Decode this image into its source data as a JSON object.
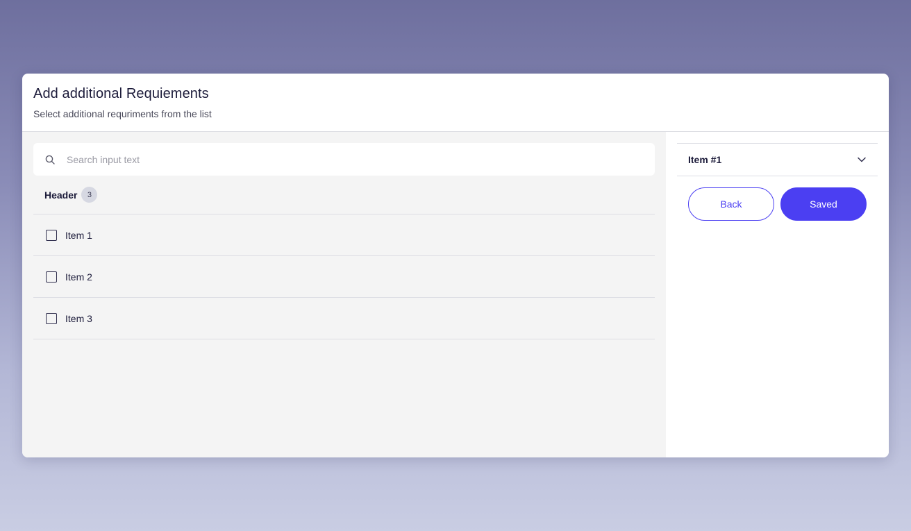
{
  "modal": {
    "title": "Add additional Requiements",
    "subtitle": "Select additional requriments from the list"
  },
  "search": {
    "placeholder": "Search input text",
    "icon": "search-icon"
  },
  "list": {
    "header_label": "Header",
    "count": "3",
    "items": [
      {
        "label": "Item 1",
        "checked": false
      },
      {
        "label": "Item 2",
        "checked": false
      },
      {
        "label": "Item 3",
        "checked": false
      }
    ]
  },
  "side_panel": {
    "accordion_label": "Item #1",
    "accordion_icon": "chevron-down-icon",
    "back_label": "Back",
    "saved_label": "Saved"
  },
  "colors": {
    "accent": "#4b3ff2",
    "text_dark": "#1c1b3a",
    "pane_background": "#f4f4f4"
  }
}
